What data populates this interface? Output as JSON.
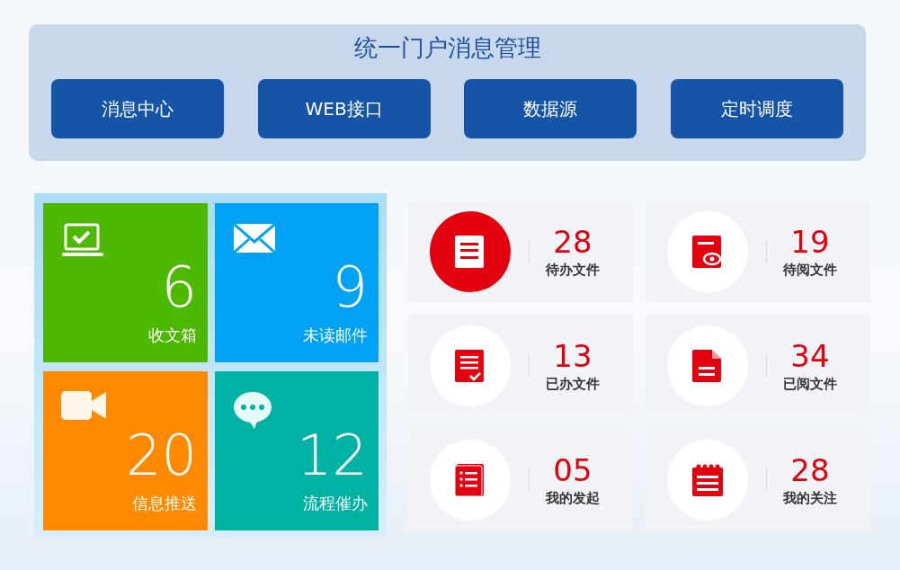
{
  "header": {
    "title": "统一门户消息管理",
    "buttons": [
      "消息中心",
      "WEB接口",
      "数据源",
      "定时调度"
    ]
  },
  "tiles": [
    {
      "kind": "inbox",
      "count": "6",
      "label": "收文箱",
      "color": "#4cb800"
    },
    {
      "kind": "mail",
      "count": "9",
      "label": "未读邮件",
      "color": "#00a2f5"
    },
    {
      "kind": "video",
      "count": "20",
      "label": "信息推送",
      "color": "#ff8a00"
    },
    {
      "kind": "chat",
      "count": "12",
      "label": "流程催办",
      "color": "#00b2a4"
    }
  ],
  "stats": [
    {
      "kind": "todo",
      "count": "28",
      "label": "待办文件",
      "selected": true
    },
    {
      "kind": "toread",
      "count": "19",
      "label": "待阅文件",
      "selected": false
    },
    {
      "kind": "done",
      "count": "13",
      "label": "已办文件",
      "selected": false
    },
    {
      "kind": "read",
      "count": "34",
      "label": "已阅文件",
      "selected": false
    },
    {
      "kind": "started",
      "count": "05",
      "label": "我的发起",
      "selected": false
    },
    {
      "kind": "followed",
      "count": "28",
      "label": "我的关注",
      "selected": false
    }
  ]
}
